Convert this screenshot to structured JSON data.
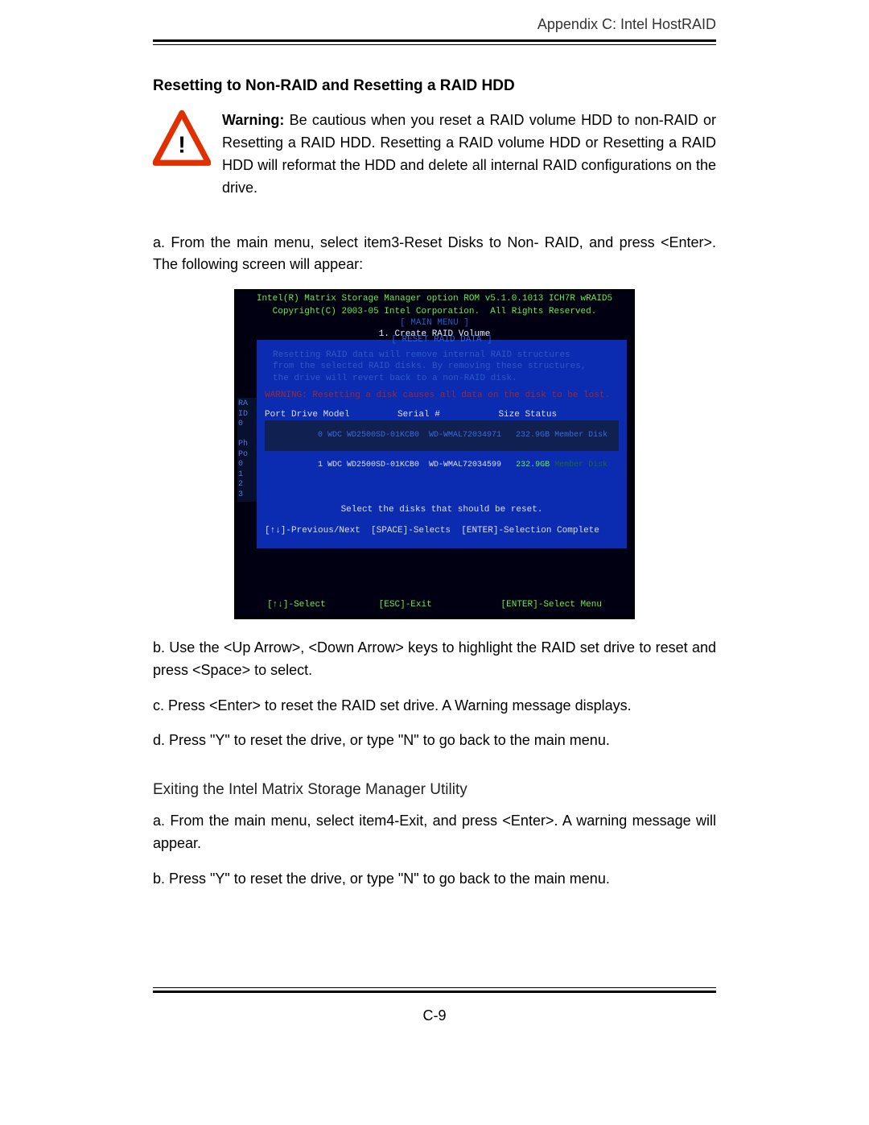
{
  "header": {
    "running_head": "Appendix C: Intel HostRAID"
  },
  "section": {
    "title": "Resetting to Non-RAID and Resetting a RAID HDD",
    "warning_label": "Warning:",
    "warning_body": " Be cautious when you reset a RAID volume HDD to non-RAID or Resetting a RAID HDD. Resetting a RAID volume HDD or Resetting a RAID HDD will reformat the HDD and delete all internal RAID configurations on the drive.",
    "step_a": "a. From the main menu, select item3-Reset Disks to Non- RAID, and press <Enter>. The following screen will appear:",
    "step_b": "b. Use the <Up Arrow>, <Down Arrow> keys to highlight the RAID set drive to reset and press <Space> to select.",
    "step_c": "c. Press <Enter> to  reset the RAID set drive. A Warning message displays.",
    "step_d": "d. Press \"Y\" to reset the drive, or type \"N\" to go back to the  main menu."
  },
  "exit_section": {
    "heading": "Exiting the Intel Matrix Storage Manager Utility",
    "step_a": "a. From the main menu, select item4-Exit, and press <Enter>. A warning message will appear.",
    "step_b": "b. Press \"Y\" to reset the drive, or type \"N\" to go back to the  main menu."
  },
  "bios": {
    "title_line1": "Intel(R) Matrix Storage Manager option ROM v5.1.0.1013 ICH7R wRAID5",
    "title_line2": "Copyright(C) 2003-05 Intel Corporation.  All Rights Reserved.",
    "main_menu_label": "[ MAIN MENU ]",
    "menu_item1": "1.  Create RAID Volume",
    "reset_label": "[ RESET RAID DATA ]",
    "desc_l1": "Resetting RAID data will remove internal RAID structures",
    "desc_l2": "from the selected RAID disks. By removing these structures,",
    "desc_l3": "the drive will revert back to a non-RAID disk.",
    "warn": "WARNING: Resetting a disk causes all data on the disk to be lost.",
    "cols": "Port Drive Model         Serial #           Size Status",
    "row1_port": " 0 WDC WD2500SD-01KCB0  WD-WMAL72034971   232.9GB Member Disk",
    "row2_port": " 1 WDC WD2500SD-01KCB0  WD-WMAL72034599   ",
    "row2_size": "232.9GB ",
    "row2_status": "Member Disk",
    "left_strip": "RA\nID\n0\n\nPh\nPo\n0\n1\n2\n3",
    "select_line": "Select the disks that should be reset.",
    "keys_line": "[↑↓]-Previous/Next  [SPACE]-Selects  [ENTER]-Selection Complete",
    "footer": "[↑↓]-Select          [ESC]-Exit             [ENTER]-Select Menu"
  },
  "page_number": "C-9"
}
